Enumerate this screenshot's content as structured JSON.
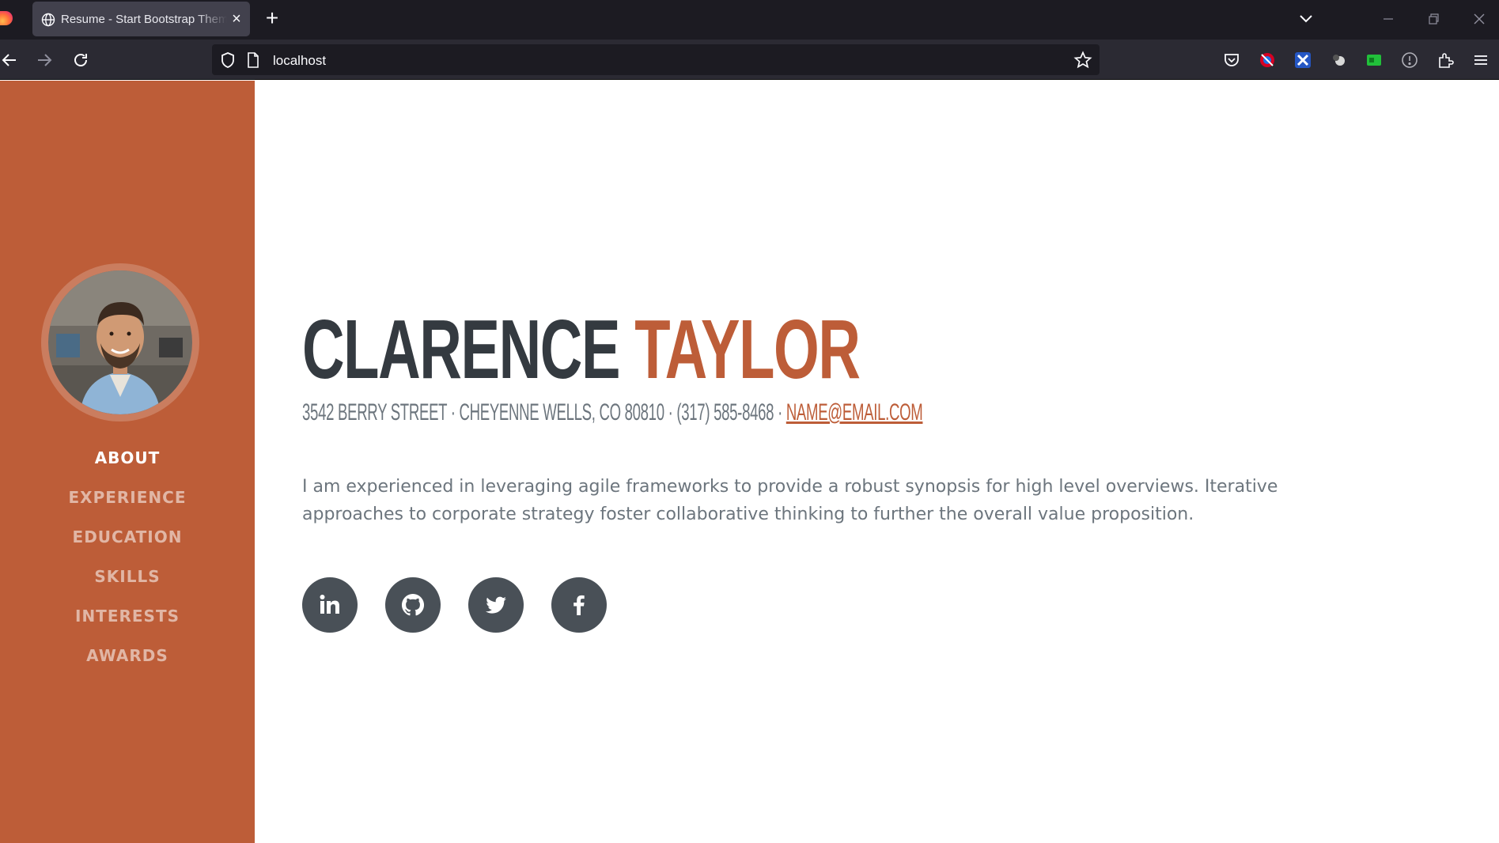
{
  "browser": {
    "tab_title": "Resume - Start Bootstrap Theme",
    "url": "localhost"
  },
  "sidebar": {
    "nav": [
      {
        "label": "ABOUT",
        "active": true
      },
      {
        "label": "EXPERIENCE",
        "active": false
      },
      {
        "label": "EDUCATION",
        "active": false
      },
      {
        "label": "SKILLS",
        "active": false
      },
      {
        "label": "INTERESTS",
        "active": false
      },
      {
        "label": "AWARDS",
        "active": false
      }
    ]
  },
  "about": {
    "first_name": "CLARENCE",
    "last_name": "TAYLOR",
    "address": "3542 Berry Street · Cheyenne Wells, CO 80810 · (317) 585-8468 · ",
    "email": "name@email.com",
    "lead": "I am experienced in leveraging agile frameworks to provide a robust synopsis for high level overviews. Iterative approaches to corporate strategy foster collaborative thinking to further the overall value proposition."
  },
  "social": [
    "linkedin-icon",
    "github-icon",
    "twitter-icon",
    "facebook-icon"
  ],
  "colors": {
    "primary": "#bd5d38",
    "dark": "#343a40",
    "muted": "#6c757d",
    "social_bg": "#495057"
  }
}
